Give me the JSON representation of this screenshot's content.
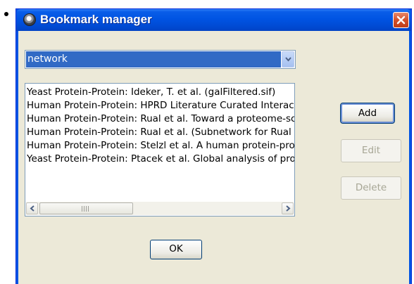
{
  "window": {
    "title": "Bookmark manager"
  },
  "category_select": {
    "selected": "network"
  },
  "bookmarks": {
    "items": [
      "Yeast Protein-Protein: Ideker, T. et al. (galFiltered.sif)",
      "Human Protein-Protein: HPRD Literature Curated Interactions",
      "Human Protein-Protein: Rual et al. Toward a proteome-scale map",
      "Human Protein-Protein: Rual et al. (Subnetwork for Rual et al.)",
      "Human Protein-Protein: Stelzl et al. A human protein-protein",
      "Yeast Protein-Protein: Ptacek et al. Global analysis of protein"
    ]
  },
  "buttons": {
    "add": "Add",
    "edit": "Edit",
    "delete": "Delete",
    "ok": "OK"
  },
  "colors": {
    "titlebar": "#0054e3",
    "selection": "#316ac5",
    "dialog_bg": "#ece9d8"
  }
}
